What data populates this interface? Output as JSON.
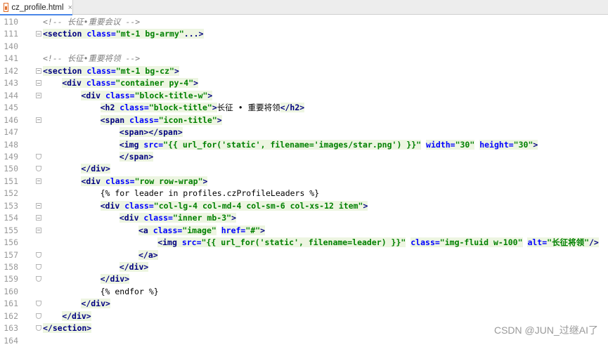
{
  "tab": {
    "filename": "cz_profile.html",
    "close": "×"
  },
  "watermark": "CSDN @JUN_过继AI了",
  "lines": [
    {
      "num": "110",
      "fold": "none",
      "indent": 0,
      "tokens": [
        [
          "cm",
          "<!-- 长征•重要会议 -->"
        ]
      ]
    },
    {
      "num": "111",
      "fold": "closed",
      "indent": 0,
      "tokens": [
        [
          "tag",
          "<section "
        ],
        [
          "attr",
          "class="
        ],
        [
          "str",
          "\"mt-1 bg-army\""
        ],
        [
          "tag",
          "...>"
        ]
      ]
    },
    {
      "num": "140",
      "fold": "none",
      "indent": 0,
      "tokens": []
    },
    {
      "num": "141",
      "fold": "none",
      "indent": 0,
      "tokens": [
        [
          "cm",
          "<!-- 长征•重要将领 -->"
        ]
      ]
    },
    {
      "num": "142",
      "fold": "open",
      "indent": 0,
      "tokens": [
        [
          "tag",
          "<section "
        ],
        [
          "attr",
          "class="
        ],
        [
          "str",
          "\"mt-1 bg-cz\""
        ],
        [
          "tag",
          ">"
        ]
      ]
    },
    {
      "num": "143",
      "fold": "open",
      "indent": 1,
      "tokens": [
        [
          "tag",
          "<div "
        ],
        [
          "attr",
          "class="
        ],
        [
          "str",
          "\"container py-4\""
        ],
        [
          "tag",
          ">"
        ]
      ]
    },
    {
      "num": "144",
      "fold": "open",
      "indent": 2,
      "tokens": [
        [
          "tag",
          "<div "
        ],
        [
          "attr",
          "class="
        ],
        [
          "str",
          "\"block-title-w\""
        ],
        [
          "tag",
          ">"
        ]
      ]
    },
    {
      "num": "145",
      "fold": "none",
      "indent": 3,
      "tokens": [
        [
          "tag",
          "<h2 "
        ],
        [
          "attr",
          "class="
        ],
        [
          "str",
          "\"block-title\""
        ],
        [
          "tag",
          ">"
        ],
        [
          "txt",
          "长征 • 重要将领"
        ],
        [
          "tag",
          "</h2>"
        ]
      ]
    },
    {
      "num": "146",
      "fold": "open",
      "indent": 3,
      "tokens": [
        [
          "tag",
          "<span "
        ],
        [
          "attr",
          "class="
        ],
        [
          "str",
          "\"icon-title\""
        ],
        [
          "tag",
          ">"
        ]
      ]
    },
    {
      "num": "147",
      "fold": "none",
      "indent": 4,
      "tokens": [
        [
          "tag",
          "<span></span>"
        ]
      ]
    },
    {
      "num": "148",
      "fold": "none",
      "indent": 4,
      "tokens": [
        [
          "tag",
          "<img "
        ],
        [
          "attr",
          "src="
        ],
        [
          "str",
          "\"{{ url_for('static', filename='images/star.png') }}\""
        ],
        [
          "txt",
          " "
        ],
        [
          "attr",
          "width="
        ],
        [
          "str",
          "\"30\""
        ],
        [
          "txt",
          " "
        ],
        [
          "attr",
          "height="
        ],
        [
          "str",
          "\"30\""
        ],
        [
          "tag",
          ">"
        ]
      ]
    },
    {
      "num": "149",
      "fold": "end",
      "indent": 4,
      "tokens": [
        [
          "tag",
          "</span>"
        ]
      ]
    },
    {
      "num": "150",
      "fold": "end",
      "indent": 2,
      "tokens": [
        [
          "tag",
          "</div>"
        ]
      ]
    },
    {
      "num": "151",
      "fold": "open",
      "indent": 2,
      "tokens": [
        [
          "tag",
          "<div "
        ],
        [
          "attr",
          "class="
        ],
        [
          "str",
          "\"row row-wrap\""
        ],
        [
          "tag",
          ">"
        ]
      ]
    },
    {
      "num": "152",
      "fold": "none",
      "indent": 3,
      "tokens": [
        [
          "tpl",
          "{% for leader in profiles.czProfileLeaders %}"
        ]
      ]
    },
    {
      "num": "153",
      "fold": "open",
      "indent": 3,
      "tokens": [
        [
          "tag",
          "<div "
        ],
        [
          "attr",
          "class="
        ],
        [
          "str",
          "\"col-lg-4 col-md-4 col-sm-6 col-xs-12 item\""
        ],
        [
          "tag",
          ">"
        ]
      ]
    },
    {
      "num": "154",
      "fold": "open",
      "indent": 4,
      "tokens": [
        [
          "tag",
          "<div "
        ],
        [
          "attr",
          "class="
        ],
        [
          "str",
          "\"inner mb-3\""
        ],
        [
          "tag",
          ">"
        ]
      ]
    },
    {
      "num": "155",
      "fold": "open",
      "indent": 5,
      "tokens": [
        [
          "tag",
          "<a "
        ],
        [
          "attr",
          "class="
        ],
        [
          "str",
          "\"image\""
        ],
        [
          "txt",
          " "
        ],
        [
          "attr",
          "href="
        ],
        [
          "str",
          "\"#\""
        ],
        [
          "tag",
          ">"
        ]
      ]
    },
    {
      "num": "156",
      "fold": "none",
      "indent": 6,
      "tokens": [
        [
          "tag",
          "<img "
        ],
        [
          "attr",
          "src="
        ],
        [
          "str",
          "\"{{ url_for('static', filename=leader) }}\""
        ],
        [
          "txt",
          " "
        ],
        [
          "attr",
          "class="
        ],
        [
          "str",
          "\"img-fluid w-100\""
        ],
        [
          "txt",
          " "
        ],
        [
          "attr",
          "alt="
        ],
        [
          "str",
          "\"长征将领\""
        ],
        [
          "tag",
          "/>"
        ]
      ]
    },
    {
      "num": "157",
      "fold": "end",
      "indent": 5,
      "tokens": [
        [
          "tag",
          "</a>"
        ]
      ]
    },
    {
      "num": "158",
      "fold": "end",
      "indent": 4,
      "tokens": [
        [
          "tag",
          "</div>"
        ]
      ]
    },
    {
      "num": "159",
      "fold": "end",
      "indent": 3,
      "tokens": [
        [
          "tag",
          "</div>"
        ]
      ]
    },
    {
      "num": "160",
      "fold": "none",
      "indent": 3,
      "tokens": [
        [
          "tpl",
          "{% endfor %}"
        ]
      ]
    },
    {
      "num": "161",
      "fold": "end",
      "indent": 2,
      "tokens": [
        [
          "tag",
          "</div>"
        ]
      ]
    },
    {
      "num": "162",
      "fold": "end",
      "indent": 1,
      "tokens": [
        [
          "tag",
          "</div>"
        ]
      ]
    },
    {
      "num": "163",
      "fold": "end",
      "indent": 0,
      "tokens": [
        [
          "tag",
          "</section>"
        ]
      ]
    },
    {
      "num": "164",
      "fold": "none",
      "indent": 0,
      "tokens": []
    }
  ]
}
